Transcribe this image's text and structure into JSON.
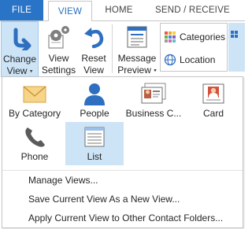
{
  "tabs": {
    "file": "FILE",
    "view": "VIEW",
    "home": "HOME",
    "send_receive": "SEND / RECEIVE"
  },
  "ribbon": {
    "change_view_line1": "Change",
    "change_view_line2": "View",
    "view_settings_line1": "View",
    "view_settings_line2": "Settings",
    "reset_view_line1": "Reset",
    "reset_view_line2": "View",
    "message_preview_line1": "Message",
    "message_preview_line2": "Preview",
    "categories": "Categories",
    "location": "Location",
    "dropdown_arrow": "▾"
  },
  "gallery": {
    "by_category": "By Category",
    "people": "People",
    "business_card": "Business C...",
    "card": "Card",
    "phone": "Phone",
    "list": "List",
    "selected": "List"
  },
  "menu": {
    "manage_views": "Manage Views...",
    "save_current_view": "Save Current View As a New View...",
    "apply_current_view": "Apply Current View to Other Contact Folders..."
  },
  "colors": {
    "file_tab": "#2a74c8",
    "accent_text": "#2a6fbf",
    "selected_bg": "#cde4f7"
  }
}
